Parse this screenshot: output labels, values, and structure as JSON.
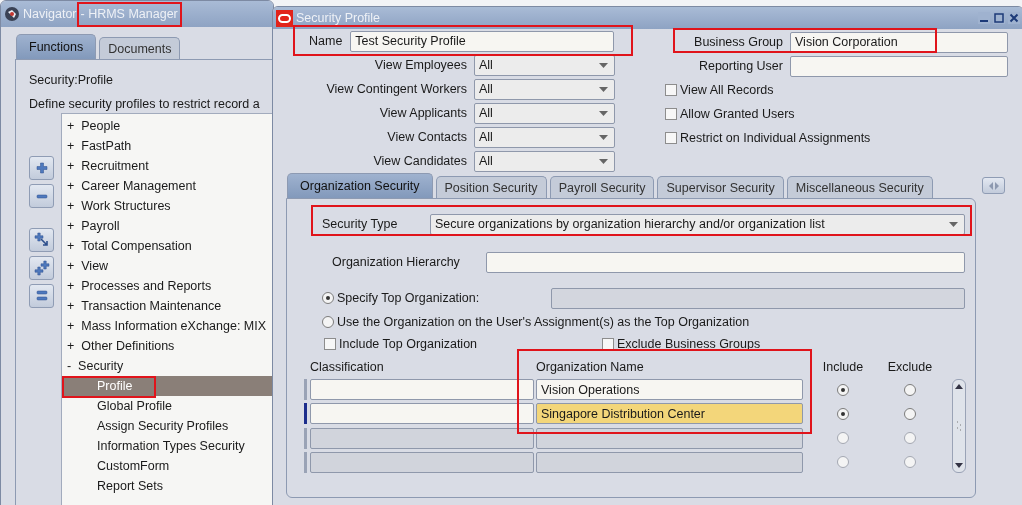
{
  "navigator": {
    "title": "Navigator",
    "subtitle": "- HRMS Manager",
    "tabs": [
      {
        "label": "Functions",
        "selected": true
      },
      {
        "label": "Documents",
        "selected": false
      }
    ],
    "heading": "Security:Profile",
    "description": "Define security profiles to restrict record a",
    "tree": [
      {
        "marker": "+",
        "label": "People",
        "selected": false
      },
      {
        "marker": "+",
        "label": "FastPath",
        "selected": false
      },
      {
        "marker": "+",
        "label": "Recruitment",
        "selected": false
      },
      {
        "marker": "+",
        "label": "Career Management",
        "selected": false
      },
      {
        "marker": "+",
        "label": "Work Structures",
        "selected": false
      },
      {
        "marker": "+",
        "label": "Payroll",
        "selected": false
      },
      {
        "marker": "+",
        "label": "Total Compensation",
        "selected": false
      },
      {
        "marker": "+",
        "label": "View",
        "selected": false
      },
      {
        "marker": "+",
        "label": "Processes and Reports",
        "selected": false
      },
      {
        "marker": "+",
        "label": "Transaction Maintenance",
        "selected": false
      },
      {
        "marker": "+",
        "label": "Mass Information eXchange: MIX",
        "selected": false
      },
      {
        "marker": "+",
        "label": "Other Definitions",
        "selected": false
      },
      {
        "marker": "-",
        "label": "Security",
        "selected": false,
        "children": [
          {
            "label": "Profile",
            "selected": true
          },
          {
            "label": "Global Profile",
            "selected": false
          },
          {
            "label": "Assign Security Profiles",
            "selected": false
          },
          {
            "label": "Information Types Security",
            "selected": false
          },
          {
            "label": "CustomForm",
            "selected": false
          },
          {
            "label": "Report Sets",
            "selected": false
          }
        ]
      }
    ]
  },
  "window": {
    "title": "Security Profile",
    "name": {
      "label": "Name",
      "value": "Test Security Profile"
    },
    "view_fields": [
      {
        "label": "View Employees",
        "value": "All"
      },
      {
        "label": "View Contingent Workers",
        "value": "All"
      },
      {
        "label": "View Applicants",
        "value": "All"
      },
      {
        "label": "View Contacts",
        "value": "All"
      },
      {
        "label": "View Candidates",
        "value": "All"
      }
    ],
    "business_group": {
      "label": "Business Group",
      "value": "Vision Corporation"
    },
    "reporting_user": {
      "label": "Reporting User"
    },
    "options": [
      {
        "label": "View All Records",
        "checked": false
      },
      {
        "label": "Allow Granted Users",
        "checked": false
      },
      {
        "label": "Restrict on Individual Assignments",
        "checked": false
      }
    ],
    "tabs": [
      {
        "label": "Organization Security",
        "selected": true
      },
      {
        "label": "Position Security",
        "selected": false
      },
      {
        "label": "Payroll Security",
        "selected": false
      },
      {
        "label": "Supervisor Security",
        "selected": false
      },
      {
        "label": "Miscellaneous Security",
        "selected": false
      }
    ],
    "security_type": {
      "label": "Security Type",
      "value": "Secure organizations by organization hierarchy and/or organization list"
    },
    "organization_hierarchy": {
      "label": "Organization Hierarchy"
    },
    "top_organization": [
      {
        "label": "Specify Top Organization:",
        "selected": true
      },
      {
        "label": "Use the Organization on the User's Assignment(s) as the Top Organization",
        "selected": false
      }
    ],
    "flags": [
      {
        "label": "Include Top Organization",
        "checked": false
      },
      {
        "label": "Exclude Business Groups",
        "checked": false
      }
    ],
    "table": {
      "columns": [
        "Classification",
        "Organization Name",
        "Include",
        "Exclude"
      ],
      "rows": [
        {
          "organization_name": "Vision Operations",
          "enabled": true,
          "current": false,
          "include": true,
          "exclude": false
        },
        {
          "organization_name": "Singapore Distribution Center",
          "enabled": true,
          "current": true,
          "include": true,
          "exclude": false
        },
        {
          "enabled": false,
          "current": false,
          "include": false,
          "exclude": false
        },
        {
          "enabled": false,
          "current": false,
          "include": false,
          "exclude": false
        }
      ]
    }
  }
}
